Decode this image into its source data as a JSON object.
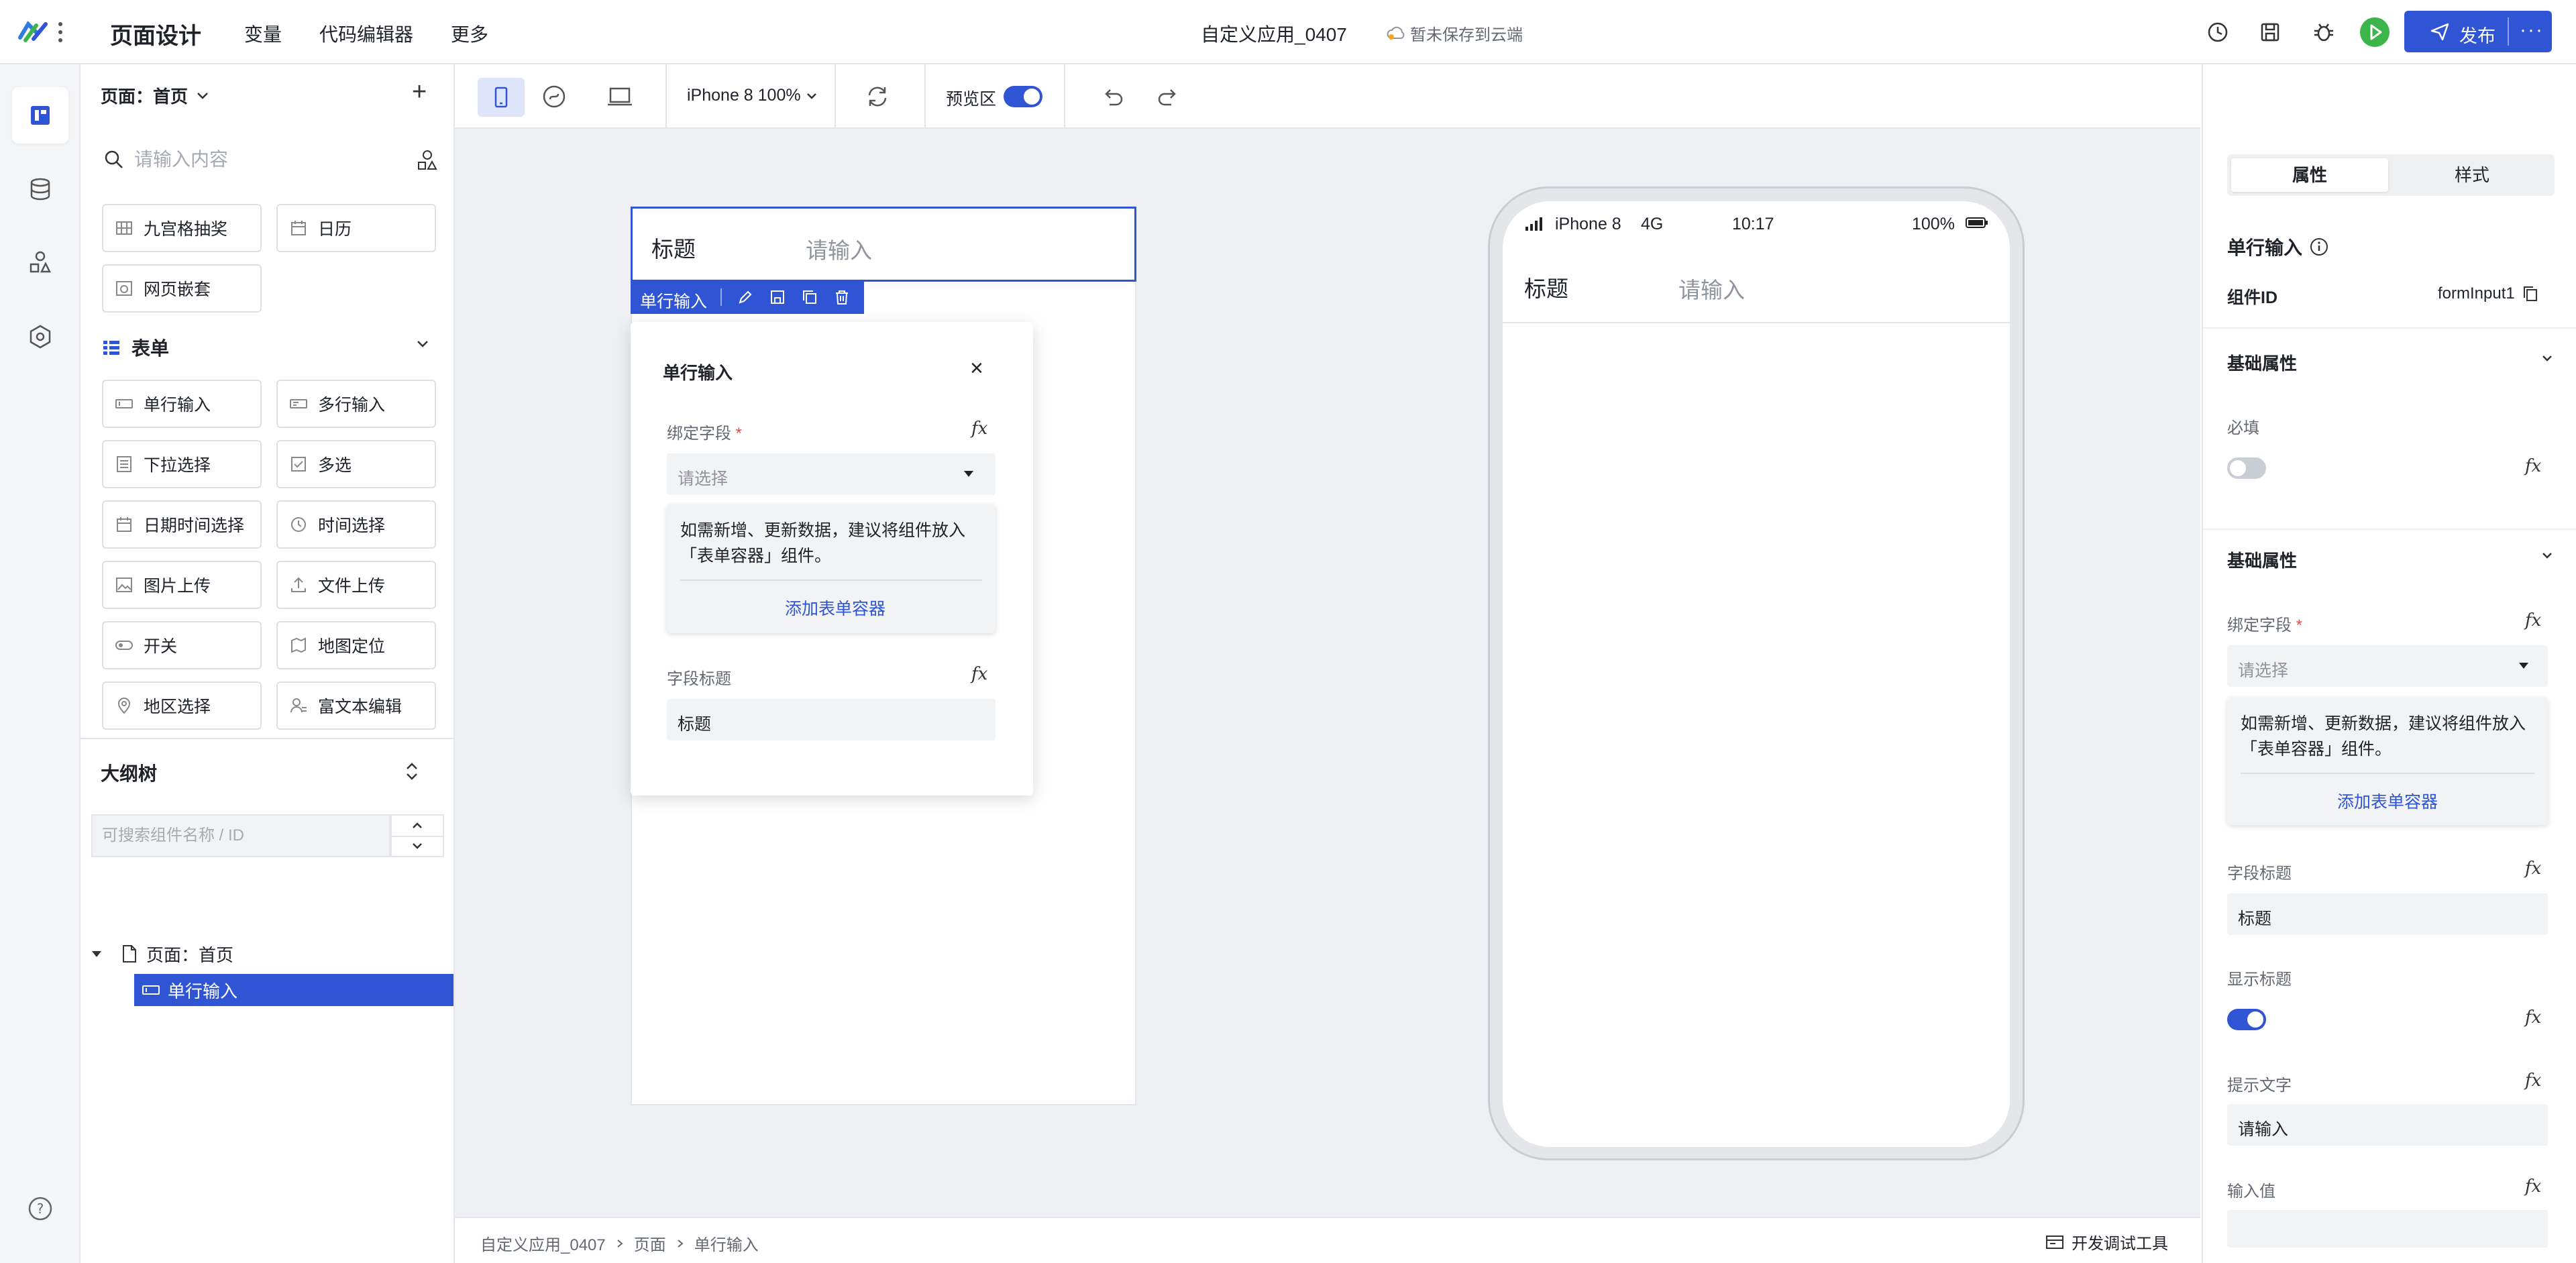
{
  "header": {
    "app_title": "页面设计",
    "nav": [
      "变量",
      "代码编辑器",
      "更多"
    ],
    "doc_name": "自定义应用_0407",
    "cloud_status": "暂未保存到云端",
    "publish_label": "发布"
  },
  "rail": {
    "items": [
      "page-design",
      "database",
      "components",
      "settings"
    ],
    "help_icon": "help-icon"
  },
  "components_panel": {
    "page_label": "页面：首页",
    "search_placeholder": "请输入内容",
    "top_items": [
      "九宫格抽奖",
      "日历",
      "网页嵌套"
    ],
    "form_group_title": "表单",
    "form_items": [
      "单行输入",
      "多行输入",
      "下拉选择",
      "多选",
      "日期时间选择",
      "时间选择",
      "图片上传",
      "文件上传",
      "开关",
      "地图定位",
      "地区选择",
      "富文本编辑"
    ]
  },
  "outline": {
    "title": "大纲树",
    "search_placeholder": "可搜索组件名称 / ID",
    "root_label": "页面：首页",
    "child_label": "单行输入"
  },
  "toolbar": {
    "device": "iPhone 8 100%",
    "preview_label": "预览区",
    "preview_on": true
  },
  "editor": {
    "input_label": "标题",
    "input_placeholder": "请输入",
    "selection_tag": "单行输入"
  },
  "popover": {
    "title": "单行输入",
    "bind_field_label": "绑定字段",
    "select_placeholder": "请选择",
    "notice_line1": "如需新增、更新数据，建议将组件放入",
    "notice_line2": "「表单容器」组件。",
    "add_container_link": "添加表单容器",
    "field_title_label": "字段标题",
    "field_title_value": "标题"
  },
  "phone": {
    "carrier": "iPhone 8",
    "network": "4G",
    "time": "10:17",
    "battery": "100%",
    "input_label": "标题",
    "input_placeholder": "请输入"
  },
  "breadcrumb": [
    "自定义应用_0407",
    "页面",
    "单行输入"
  ],
  "devtools_label": "开发调试工具",
  "props": {
    "tabs": [
      "属性",
      "样式"
    ],
    "component_name": "单行输入",
    "component_id_label": "组件ID",
    "component_id_value": "formInput1",
    "section1_title": "基础属性",
    "required_label": "必填",
    "required_on": false,
    "section2_title": "基础属性",
    "bind_field_label": "绑定字段",
    "select_placeholder": "请选择",
    "notice_line1": "如需新增、更新数据，建议将组件放入",
    "notice_line2": "「表单容器」组件。",
    "add_container_link": "添加表单容器",
    "field_title_label": "字段标题",
    "field_title_value": "标题",
    "show_title_label": "显示标题",
    "show_title_on": true,
    "hint_label": "提示文字",
    "hint_value": "请输入",
    "input_value_label": "输入值",
    "input_value": ""
  },
  "colors": {
    "accent": "#2f54d4",
    "canvas_bg": "#eef0f3",
    "required": "#f54a45",
    "run_green": "#3bb54a"
  }
}
